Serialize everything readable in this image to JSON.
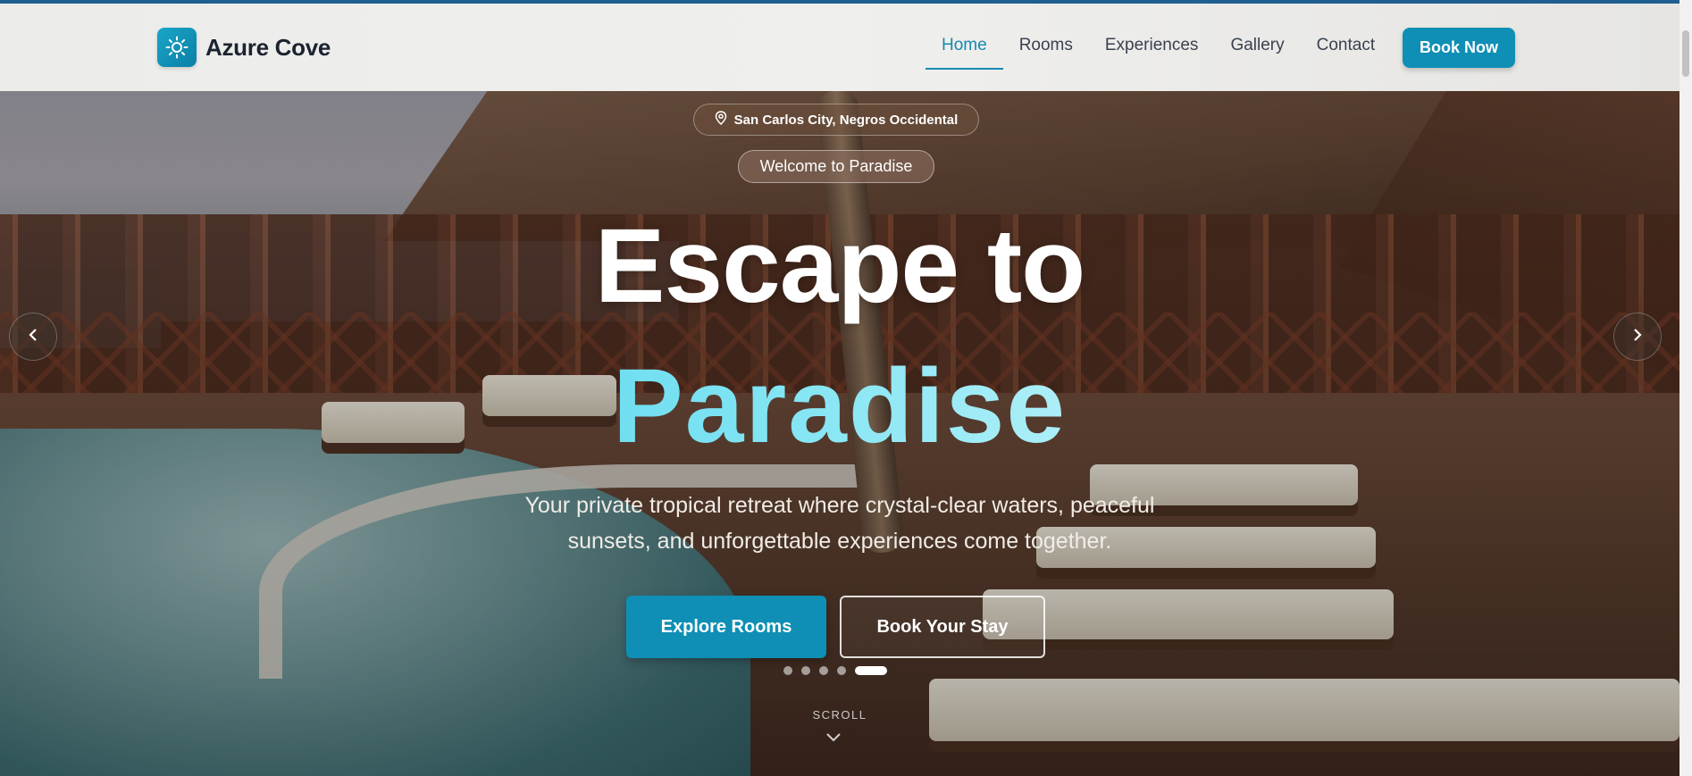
{
  "brand": {
    "name": "Azure Cove",
    "icon": "sun-icon",
    "accent": "#0f8fb5"
  },
  "nav": {
    "items": [
      {
        "label": "Home",
        "active": true
      },
      {
        "label": "Rooms",
        "active": false
      },
      {
        "label": "Experiences",
        "active": false
      },
      {
        "label": "Gallery",
        "active": false
      },
      {
        "label": "Contact",
        "active": false
      }
    ],
    "cta_label": "Book Now"
  },
  "hero": {
    "location": "San Carlos City, Negros Occidental",
    "location_icon": "map-pin-icon",
    "badge": "Welcome to Paradise",
    "title_line1": "Escape to",
    "title_line2": "Paradise",
    "subtitle": "Your private tropical retreat where crystal-clear waters, peaceful sunsets, and unforgettable experiences come together.",
    "primary_cta": "Explore Rooms",
    "secondary_cta": "Book Your Stay",
    "slides_total": 5,
    "active_slide": 5,
    "scroll_label": "SCROLL"
  }
}
